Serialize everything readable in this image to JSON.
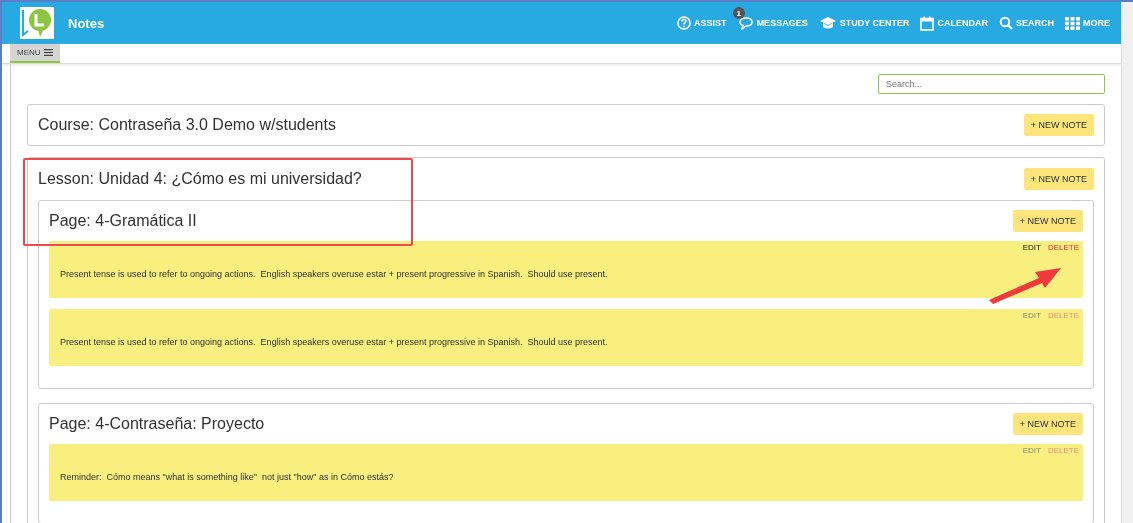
{
  "header": {
    "title": "Notes",
    "nav": [
      {
        "kind": "assist",
        "label": "ASSIST"
      },
      {
        "kind": "messages",
        "label": "MESSAGES",
        "badge": "1"
      },
      {
        "kind": "study",
        "label": "STUDY CENTER"
      },
      {
        "kind": "calendar",
        "label": "CALENDAR"
      },
      {
        "kind": "search",
        "label": "SEARCH"
      },
      {
        "kind": "more",
        "label": "MORE"
      }
    ]
  },
  "menu": {
    "label": "MENU"
  },
  "search": {
    "placeholder": "Search..."
  },
  "course": {
    "title": "Course: Contraseña 3.0 Demo w/students",
    "button": "+ NEW NOTE"
  },
  "lesson": {
    "title": "Lesson: Unidad 4: ¿Cómo es mi universidad?",
    "button": "+ NEW NOTE",
    "pages": [
      {
        "title": "Page: 4-Gramática II",
        "button": "+ NEW NOTE",
        "notes": [
          {
            "text": "Present tense is used to refer to ongoing actions.  English speakers overuse estar + present progressive in Spanish.  Should use present.",
            "edit": "EDIT",
            "delete": "DELETE",
            "highlighted": true
          },
          {
            "text": "Present tense is used to refer to ongoing actions.  English speakers overuse estar + present progressive in Spanish.  Should use present.",
            "edit": "EDIT",
            "delete": "DELETE",
            "highlighted": false
          }
        ]
      },
      {
        "title": "Page: 4-Contraseña: Proyecto",
        "button": "+ NEW NOTE",
        "notes": [
          {
            "text": "Reminder:  Cómo means \"what is something like\"  not just \"how\" as in Cómo estás?",
            "edit": "EDIT",
            "delete": "DELETE",
            "highlighted": false
          }
        ]
      }
    ]
  }
}
